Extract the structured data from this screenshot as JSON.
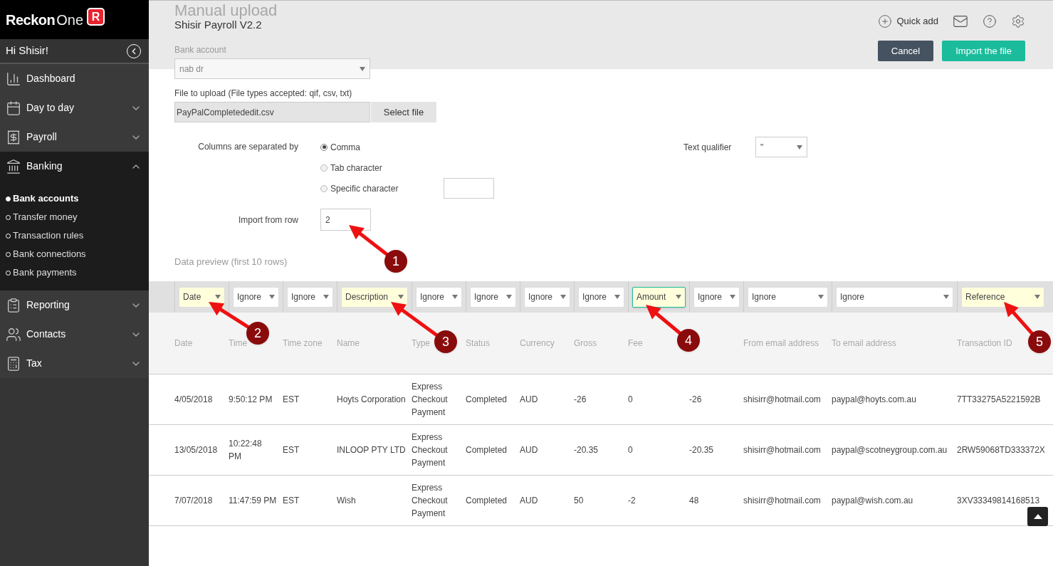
{
  "logo": {
    "name": "Reckon",
    "suffix": "One",
    "badge": "R"
  },
  "sidebar": {
    "greeting": "Hi Shisir!",
    "items": [
      {
        "label": "Dashboard",
        "expandable": false,
        "expanded": false
      },
      {
        "label": "Day to day",
        "expandable": true,
        "expanded": false
      },
      {
        "label": "Payroll",
        "expandable": true,
        "expanded": false
      },
      {
        "label": "Banking",
        "expandable": true,
        "expanded": true,
        "children": [
          {
            "label": "Bank accounts",
            "selected": true
          },
          {
            "label": "Transfer money",
            "selected": false
          },
          {
            "label": "Transaction rules",
            "selected": false
          },
          {
            "label": "Bank connections",
            "selected": false
          },
          {
            "label": "Bank payments",
            "selected": false
          }
        ]
      },
      {
        "label": "Reporting",
        "expandable": true,
        "expanded": false
      },
      {
        "label": "Contacts",
        "expandable": true,
        "expanded": false
      },
      {
        "label": "Tax",
        "expandable": true,
        "expanded": false
      }
    ]
  },
  "header": {
    "page_title": "Manual upload",
    "company": "Shisir Payroll V2.2",
    "quick_add": "Quick add",
    "buttons": [
      {
        "label": "Cancel",
        "kind": "secondary"
      },
      {
        "label": "Import the file",
        "kind": "primary"
      }
    ]
  },
  "form": {
    "bank_account": {
      "label": "Bank account",
      "value": "nab dr"
    },
    "file": {
      "label": "File to upload (File types accepted: qif, csv, txt)",
      "value": "PayPalCompletededit.csv",
      "button": "Select file"
    },
    "separator": {
      "label": "Columns are separated by",
      "options": [
        {
          "label": "Comma",
          "selected": true
        },
        {
          "label": "Tab character",
          "selected": false
        },
        {
          "label": "Specific character",
          "selected": false
        }
      ]
    },
    "text_qualifier": {
      "label": "Text qualifier",
      "value": "\""
    },
    "import_from_row": {
      "label": "Import from row",
      "value": "2"
    },
    "preview_label": "Data preview (first 10 rows)"
  },
  "table": {
    "mappings": [
      {
        "value": "Date",
        "mapped": true,
        "focused": false
      },
      {
        "value": "Ignore",
        "mapped": false,
        "focused": false
      },
      {
        "value": "Ignore",
        "mapped": false,
        "focused": false
      },
      {
        "value": "Description",
        "mapped": true,
        "focused": false
      },
      {
        "value": "Ignore",
        "mapped": false,
        "focused": false
      },
      {
        "value": "Ignore",
        "mapped": false,
        "focused": false
      },
      {
        "value": "Ignore",
        "mapped": false,
        "focused": false
      },
      {
        "value": "Ignore",
        "mapped": false,
        "focused": false
      },
      {
        "value": "Amount",
        "mapped": true,
        "focused": true
      },
      {
        "value": "Ignore",
        "mapped": false,
        "focused": false
      },
      {
        "value": "Ignore",
        "mapped": false,
        "focused": false
      },
      {
        "value": "Ignore",
        "mapped": false,
        "focused": false
      },
      {
        "value": "Reference",
        "mapped": true,
        "focused": false
      }
    ],
    "columns": [
      {
        "label": "Date"
      },
      {
        "label": "Time"
      },
      {
        "label": "Time zone"
      },
      {
        "label": "Name"
      },
      {
        "label": "Type"
      },
      {
        "label": "Status"
      },
      {
        "label": "Currency"
      },
      {
        "label": "Gross"
      },
      {
        "label": "Fee"
      },
      {},
      {
        "label": "From email address"
      },
      {
        "label": "To email address"
      },
      {
        "label": "Transaction ID"
      }
    ],
    "rows": [
      [
        "4/05/2018",
        "9:50:12 PM",
        "EST",
        "Hoyts Corporation",
        "Express Checkout Payment",
        "Completed",
        "AUD",
        "-26",
        "0",
        "-26",
        "shisirr@hotmail.com",
        "paypal@hoyts.com.au",
        "7TT33275A5221592B"
      ],
      [
        "13/05/2018",
        "10:22:48 PM",
        "EST",
        "INLOOP PTY LTD",
        "Express Checkout Payment",
        "Completed",
        "AUD",
        "-20.35",
        "0",
        "-20.35",
        "shisirr@hotmail.com",
        "paypal@scotneygroup.com.au",
        "2RW59068TD333372X"
      ],
      [
        "7/07/2018",
        "11:47:59 PM",
        "EST",
        "Wish",
        "Express Checkout Payment",
        "Completed",
        "AUD",
        "50",
        "-2",
        "48",
        "shisirr@hotmail.com",
        "paypal@wish.com.au",
        "3XV33349814168513"
      ]
    ]
  },
  "annotations": [
    {
      "number": "1"
    },
    {
      "number": "2"
    },
    {
      "number": "3"
    },
    {
      "number": "4"
    },
    {
      "number": "5"
    }
  ]
}
